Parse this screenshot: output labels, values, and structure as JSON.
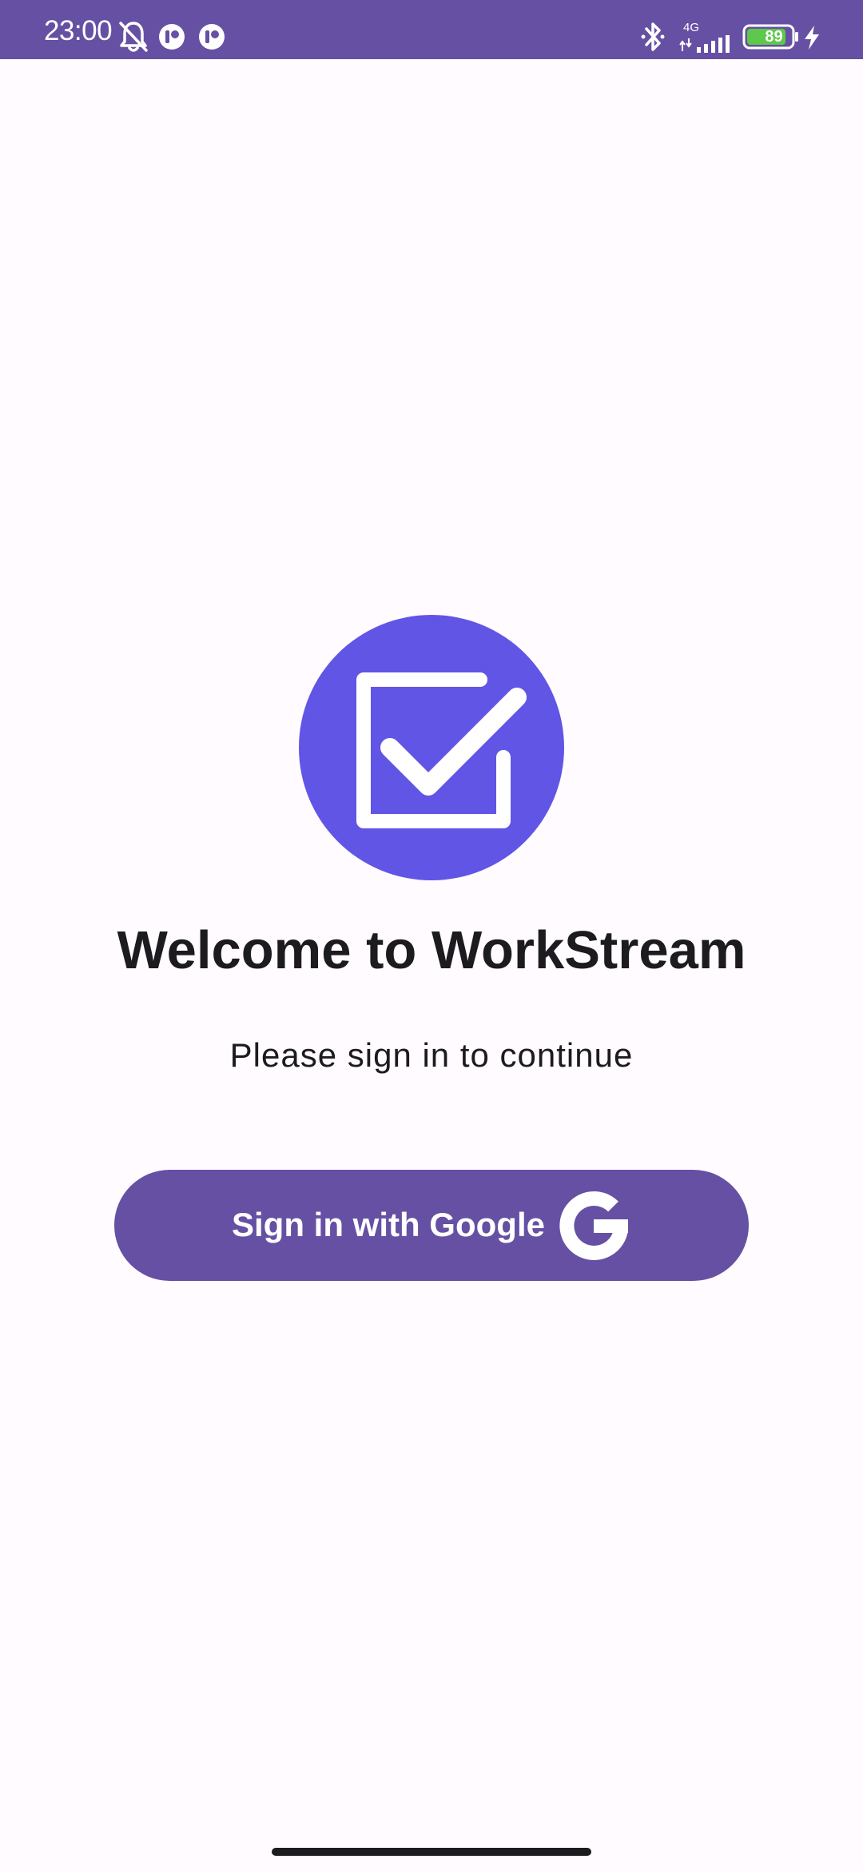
{
  "status_bar": {
    "time": "23:00",
    "battery_level": "89",
    "network": "4G",
    "icons": [
      "muted-bell-icon",
      "app-notification-icon",
      "app-notification-icon",
      "bluetooth-icon",
      "signal-icon",
      "battery-icon",
      "charging-icon"
    ]
  },
  "logo": {
    "icon": "checkbox-checked-icon",
    "color": "#6155e6"
  },
  "welcome": {
    "title": "Welcome to WorkStream",
    "subtitle": "Please sign in to continue"
  },
  "signin": {
    "label": "Sign in with Google",
    "icon": "google-icon",
    "color": "#6650a4"
  },
  "theme": {
    "primary": "#6650a4",
    "background": "#fffbfe",
    "text": "#1c1b1f"
  }
}
